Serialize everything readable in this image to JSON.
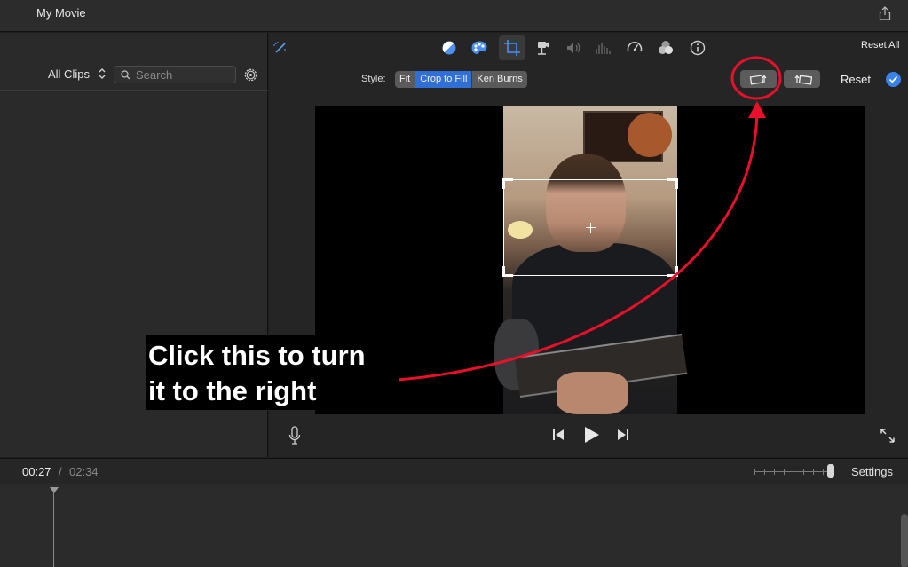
{
  "window": {
    "title": "My Movie"
  },
  "library": {
    "filter_label": "All Clips",
    "search_placeholder": "Search"
  },
  "viewer": {
    "reset_all_label": "Reset All",
    "style_label": "Style:",
    "style_options": [
      "Fit",
      "Crop to Fill",
      "Ken Burns"
    ],
    "selected_style": "Crop to Fill",
    "reset_label": "Reset"
  },
  "timeline": {
    "current_time": "00:27",
    "separator": "/",
    "total_time": "02:34",
    "settings_label": "Settings"
  },
  "annotation": {
    "line1": "Click this to turn",
    "line2": "it to the right",
    "color": "#e8102a"
  },
  "colors": {
    "accent": "#2f6fd6",
    "background": "#1e1e1e",
    "panel": "#2a2a2a"
  },
  "icons": {
    "toolbar": [
      "magic-wand-icon",
      "color-balance-icon",
      "color-correction-icon",
      "crop-icon",
      "stabilization-icon",
      "volume-icon",
      "equalizer-icon",
      "speed-icon",
      "clip-filter-icon",
      "info-icon"
    ],
    "rotate": [
      "rotate-left-icon",
      "rotate-right-icon"
    ]
  }
}
